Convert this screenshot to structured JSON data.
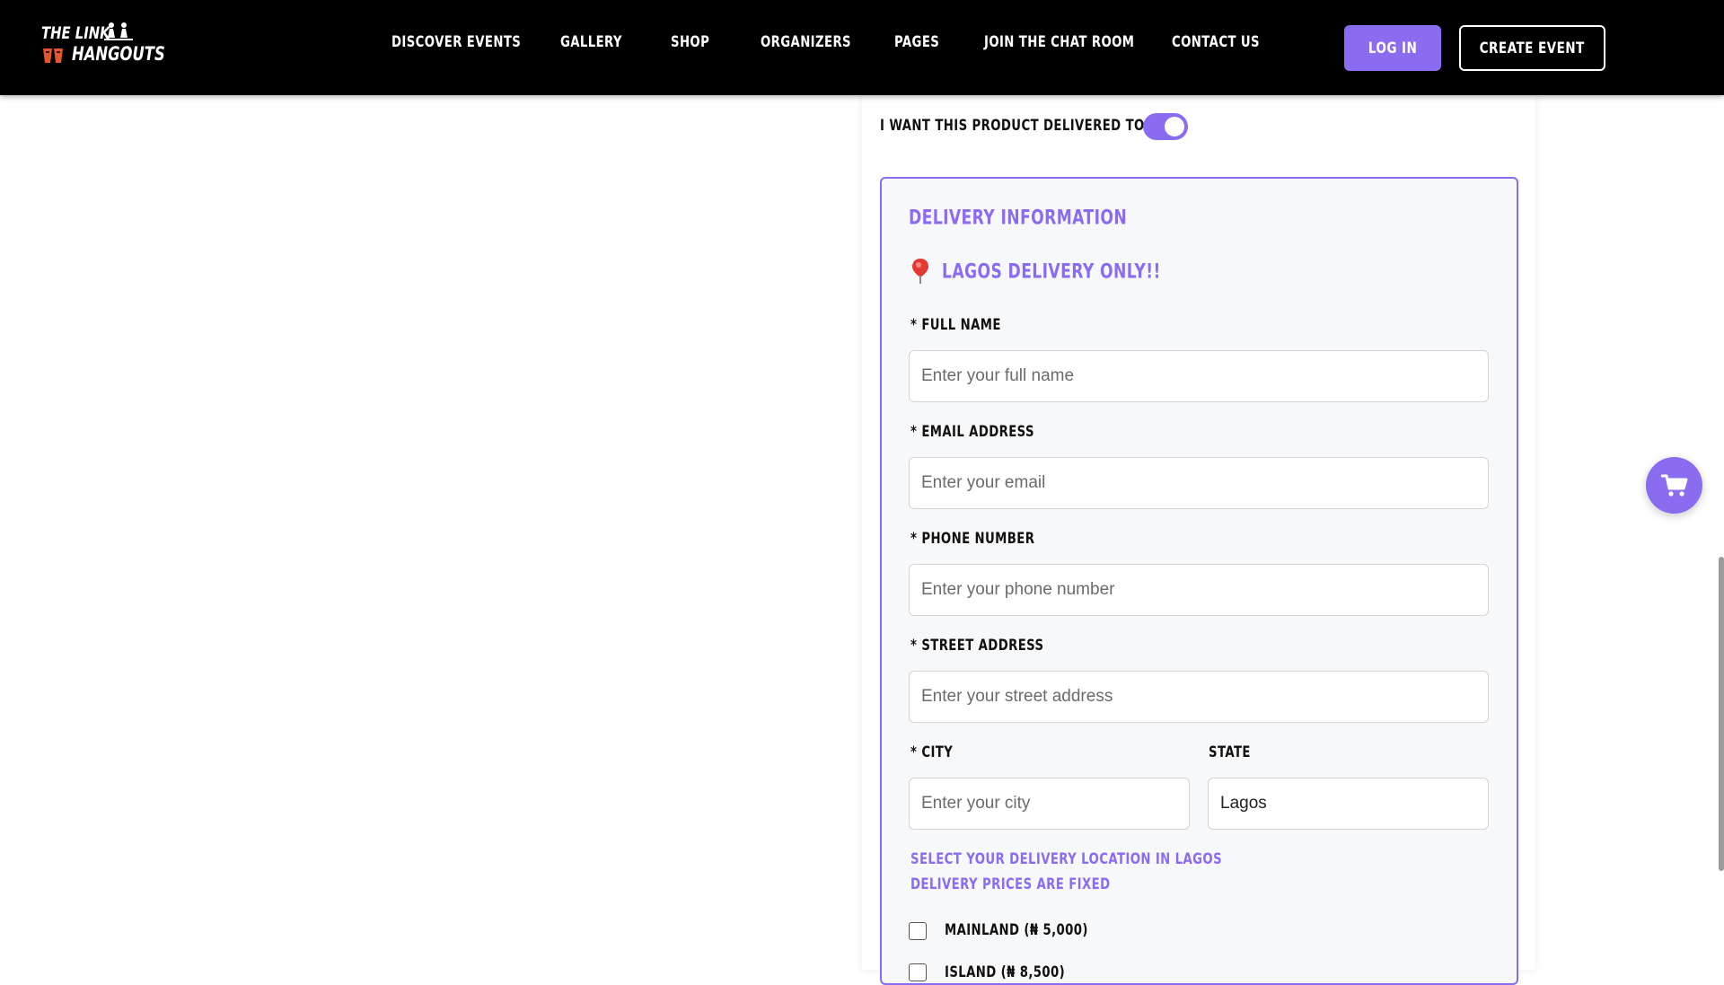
{
  "header": {
    "logo": {
      "line1": "THE LINK",
      "line2": "HANGOUTS"
    },
    "nav": [
      {
        "id": "discover",
        "label": "DISCOVER EVENTS"
      },
      {
        "id": "gallery",
        "label": "GALLERY"
      },
      {
        "id": "shop",
        "label": "SHOP"
      },
      {
        "id": "organizers",
        "label": "ORGANIZERS"
      },
      {
        "id": "pages",
        "label": "PAGES"
      },
      {
        "id": "chat",
        "label": "JOIN THE CHAT ROOM"
      },
      {
        "id": "contact",
        "label": "CONTACT US"
      }
    ],
    "login_label": "LOG IN",
    "create_event_label": "CREATE EVENT"
  },
  "delivery_toggle": {
    "label": "I WANT THIS PRODUCT DELIVERED TO ME",
    "on": true
  },
  "delivery": {
    "title": "DELIVERY INFORMATION",
    "note": "LAGOS DELIVERY ONLY!!",
    "fields": {
      "full_name": {
        "label": "* FULL NAME",
        "placeholder": "Enter your full name",
        "value": ""
      },
      "email": {
        "label": "* EMAIL ADDRESS",
        "placeholder": "Enter your email",
        "value": ""
      },
      "phone": {
        "label": "* PHONE NUMBER",
        "placeholder": "Enter your phone number",
        "value": ""
      },
      "street": {
        "label": "* STREET ADDRESS",
        "placeholder": "Enter your street address",
        "value": ""
      },
      "city": {
        "label": "* CITY",
        "placeholder": "Enter your city",
        "value": ""
      },
      "state": {
        "label": "STATE",
        "value": "Lagos"
      }
    },
    "hint_line1": "SELECT YOUR DELIVERY LOCATION IN LAGOS",
    "hint_line2": "DELIVERY PRICES ARE FIXED",
    "locations": [
      {
        "label": "MAINLAND (₦ 5,000)",
        "checked": false
      },
      {
        "label": "ISLAND (₦ 8,500)",
        "checked": false
      }
    ]
  },
  "colors": {
    "accent": "#8b6cf0",
    "header_bg": "#000000",
    "logo_accent": "#e4572e"
  },
  "icons": {
    "cart": "cart-icon",
    "pin": "map-pin-icon"
  }
}
